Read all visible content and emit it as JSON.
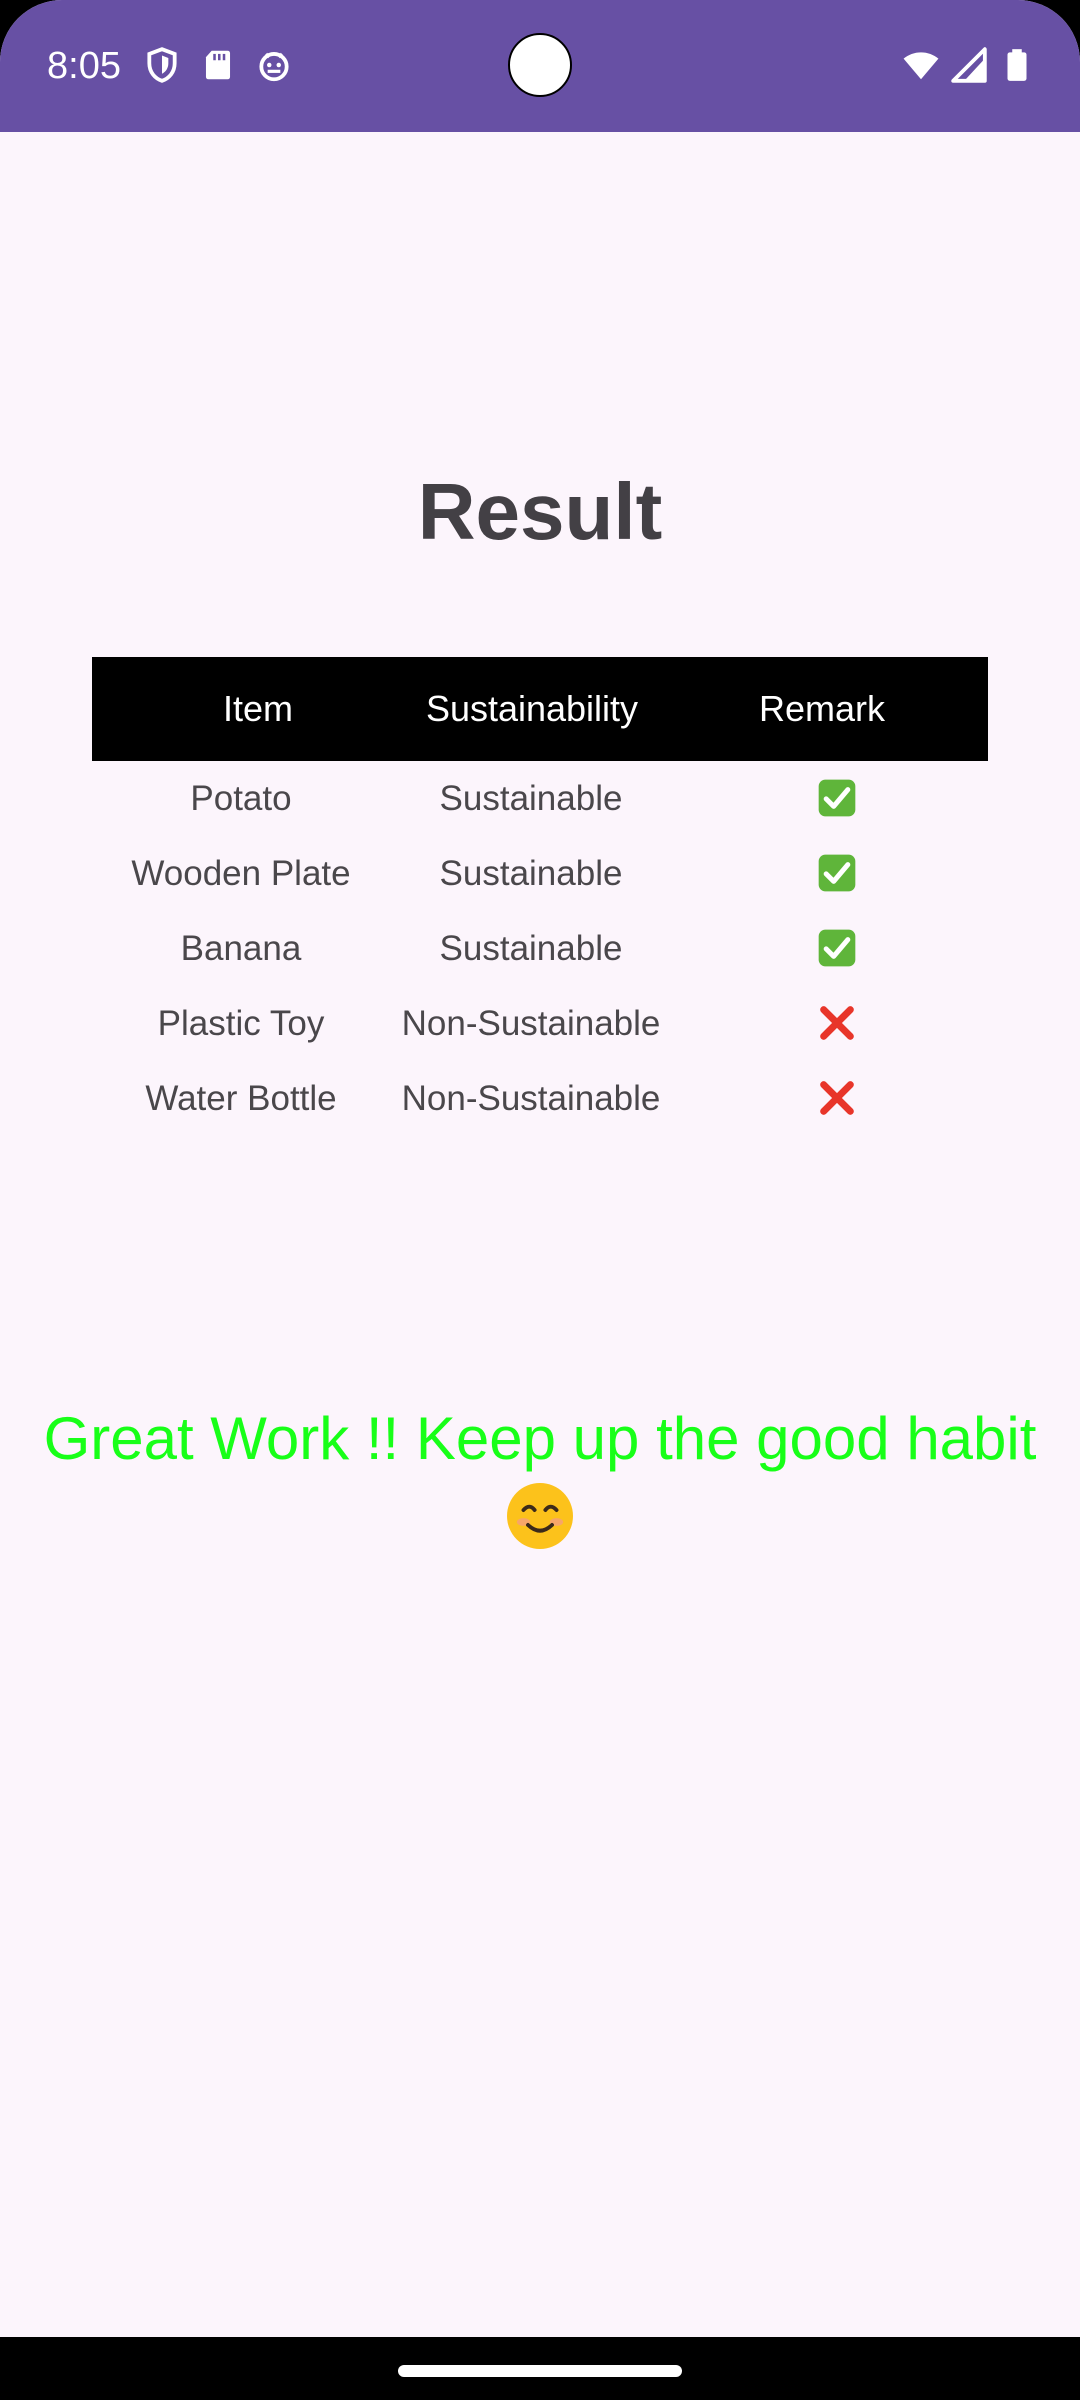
{
  "status_bar": {
    "time": "8:05",
    "icons_left": [
      "shield-icon",
      "sd-card-icon",
      "android-debug-icon"
    ],
    "icons_right": [
      "wifi-icon",
      "signal-icon",
      "battery-icon"
    ],
    "background": "#6750a4"
  },
  "page": {
    "title": "Result"
  },
  "table": {
    "headers": {
      "item": "Item",
      "sustainability": "Sustainability",
      "remark": "Remark"
    },
    "rows": [
      {
        "item": "Potato",
        "sustainability": "Sustainable",
        "remark": "check-mark-icon"
      },
      {
        "item": "Wooden Plate",
        "sustainability": "Sustainable",
        "remark": "check-mark-icon"
      },
      {
        "item": "Banana",
        "sustainability": "Sustainable",
        "remark": "check-mark-icon"
      },
      {
        "item": "Plastic Toy",
        "sustainability": "Non-Sustainable",
        "remark": "cross-mark-icon"
      },
      {
        "item": "Water Bottle",
        "sustainability": "Non-Sustainable",
        "remark": "cross-mark-icon"
      }
    ]
  },
  "message": {
    "text": "Great Work !! Keep up the good habit",
    "emoji": "smiling-face-icon",
    "color": "#18ff18"
  }
}
